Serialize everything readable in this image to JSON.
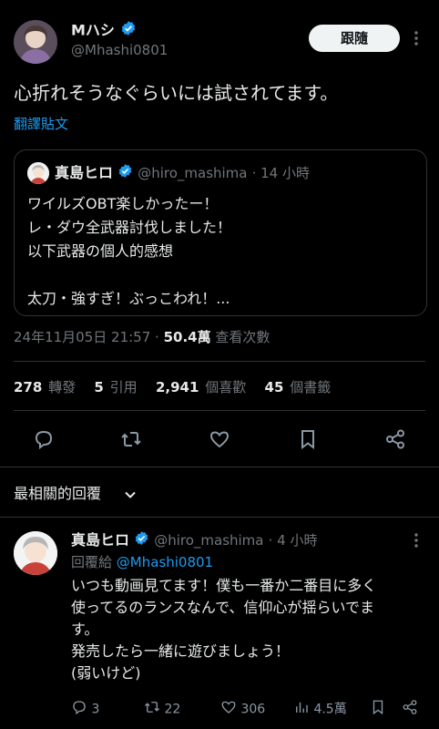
{
  "tweet": {
    "author_name": "Mハシ",
    "author_handle": "@Mhashi0801",
    "follow_label": "跟隨",
    "text": "心折れそうなぐらいには試されてます。",
    "translate_label": "翻譯貼文",
    "timestamp": "24年11月05日 21:57",
    "dot": "·",
    "views_count": "50.4萬",
    "views_label": "查看次數"
  },
  "quote": {
    "author_name": "真島ヒロ",
    "author_handle": "@hiro_mashima",
    "time": "· 14 小時",
    "lines": [
      "ワイルズOBT楽しかったー！",
      "レ・ダウ全武器討伐しました！",
      "以下武器の個人的感想",
      "",
      "太刀・強すぎ！ぶっこわれ！..."
    ]
  },
  "stats": {
    "retweets_count": "278",
    "retweets_label": "轉發",
    "quotes_count": "5",
    "quotes_label": "引用",
    "likes_count": "2,941",
    "likes_label": "個喜歡",
    "bookmarks_count": "45",
    "bookmarks_label": "個書籤"
  },
  "sort": {
    "label": "最相關的回覆"
  },
  "reply": {
    "author_name": "真島ヒロ",
    "author_handle": "@hiro_mashima",
    "time": "· 4 小時",
    "replying_to_label": "回覆給",
    "replying_to_handle": "@Mhashi0801",
    "lines": [
      "いつも動画見てます！僕も一番か二番目に多く",
      "使ってるのランスなんで、信仰心が揺らいでま",
      "す。",
      "発売したら一緒に遊びましょう！",
      "(弱いけど)"
    ],
    "replies": "3",
    "retweets": "22",
    "likes": "306",
    "views": "4.5萬"
  },
  "colors": {
    "accent": "#1d9bf0",
    "background": "#000000",
    "text": "#e7e9ea",
    "muted": "#71767b"
  }
}
